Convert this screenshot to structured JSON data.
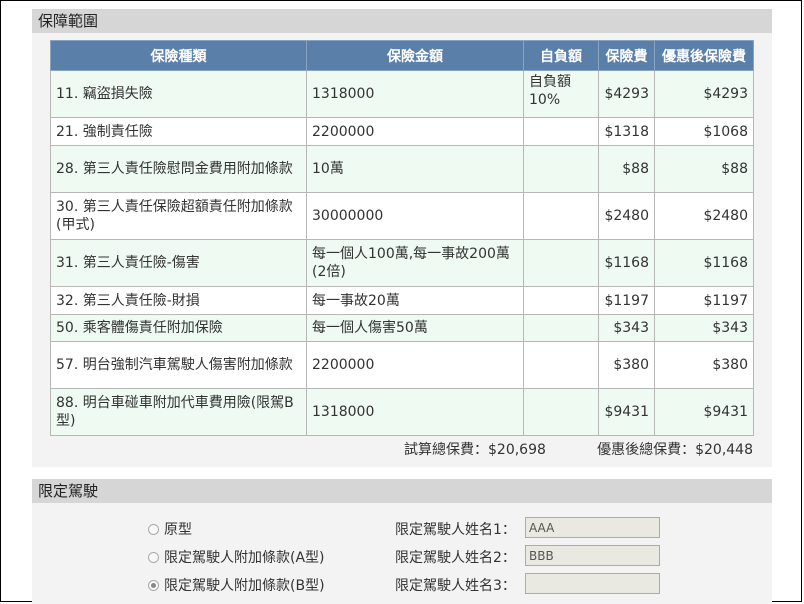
{
  "coverage": {
    "title": "保障範圍",
    "headers": [
      "保險種類",
      "保險金額",
      "自負額",
      "保險費",
      "優惠後保險費"
    ],
    "rows": [
      {
        "type": "11. 竊盜損失險",
        "amount": "1318000",
        "deductible": "自負額10%",
        "premium": "$4293",
        "discounted": "$4293"
      },
      {
        "type": "21. 強制責任險",
        "amount": "2200000",
        "deductible": "",
        "premium": "$1318",
        "discounted": "$1068"
      },
      {
        "type": "28. 第三人責任險慰問金費用附加條款",
        "amount": "10萬",
        "deductible": "",
        "premium": "$88",
        "discounted": "$88"
      },
      {
        "type": "30. 第三人責任保險超額責任附加條款(甲式)",
        "amount": "30000000",
        "deductible": "",
        "premium": "$2480",
        "discounted": "$2480"
      },
      {
        "type": "31. 第三人責任險-傷害",
        "amount": "每一個人100萬,每一事故200萬(2倍)",
        "deductible": "",
        "premium": "$1168",
        "discounted": "$1168"
      },
      {
        "type": "32. 第三人責任險-財損",
        "amount": "每一事故20萬",
        "deductible": "",
        "premium": "$1197",
        "discounted": "$1197"
      },
      {
        "type": "50. 乘客體傷責任附加保險",
        "amount": "每一個人傷害50萬",
        "deductible": "",
        "premium": "$343",
        "discounted": "$343"
      },
      {
        "type": "57. 明台強制汽車駕駛人傷害附加條款",
        "amount": "2200000",
        "deductible": "",
        "premium": "$380",
        "discounted": "$380"
      },
      {
        "type": "88. 明台車碰車附加代車費用險(限駕B型)",
        "amount": "1318000",
        "deductible": "",
        "premium": "$9431",
        "discounted": "$9431"
      }
    ],
    "total": "試算總保費：$20,698",
    "discounted_total": "優惠後總保費：$20,448"
  },
  "driver": {
    "title": "限定駕駛",
    "options": [
      {
        "label": "原型",
        "selected": false
      },
      {
        "label": "限定駕駛人附加條款(A型)",
        "selected": false
      },
      {
        "label": "限定駕駛人附加條款(B型)",
        "selected": true
      }
    ],
    "fields": [
      {
        "label": "限定駕駛人姓名1：",
        "value": "AAA"
      },
      {
        "label": "限定駕駛人姓名2：",
        "value": "BBB"
      },
      {
        "label": "限定駕駛人姓名3：",
        "value": ""
      }
    ]
  }
}
